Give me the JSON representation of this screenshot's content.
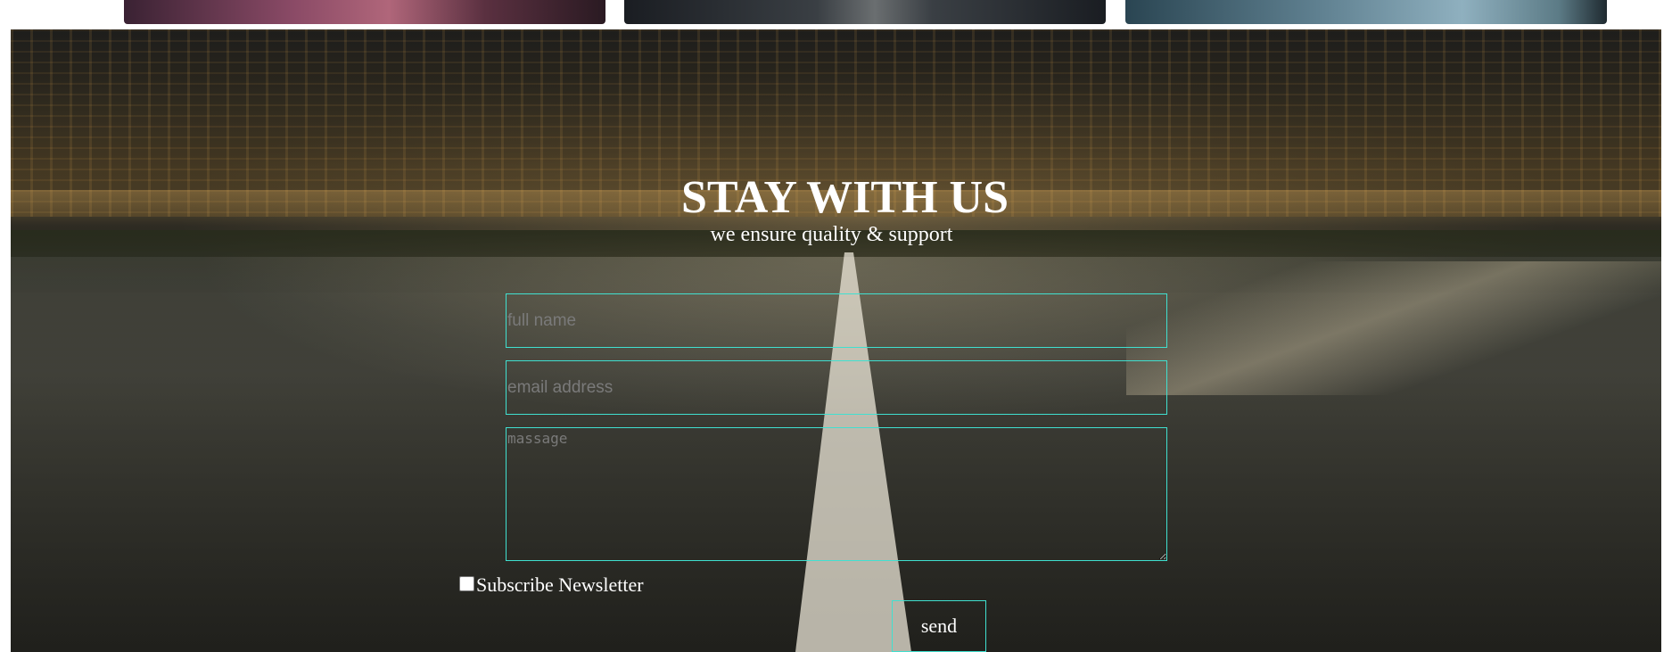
{
  "gallery": {
    "thumbnails": [
      "city-night-car",
      "road-asphalt-car",
      "blue-car"
    ]
  },
  "contact": {
    "title": "STAY WITH US",
    "subtitle": "we ensure quality & support",
    "name_placeholder": "full name",
    "email_placeholder": "email address",
    "message_placeholder": "massage",
    "newsletter_label": "Subscribe Newsletter",
    "newsletter_checked": false,
    "send_label": "send",
    "accent_color": "#40e0d0"
  }
}
